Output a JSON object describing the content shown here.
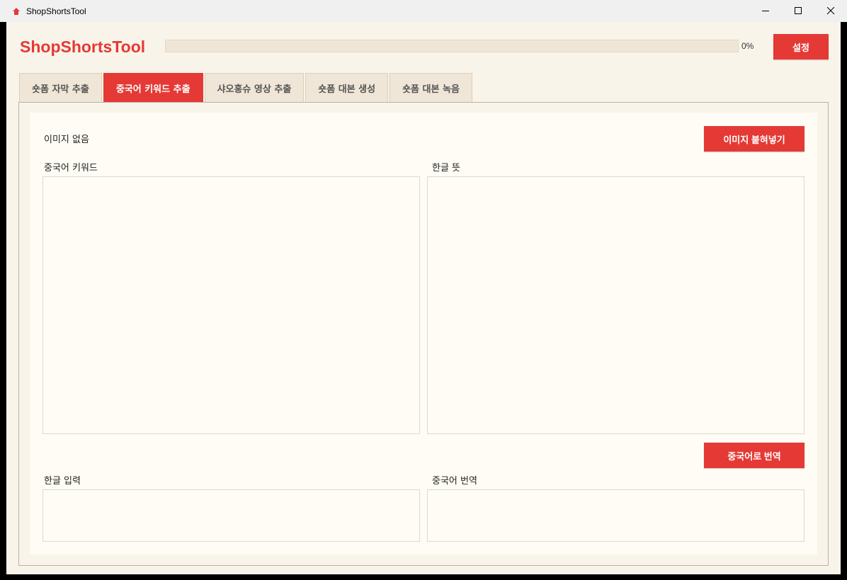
{
  "window": {
    "title": "ShopShortsTool"
  },
  "header": {
    "app_title": "ShopShortsTool",
    "progress": {
      "value": 0,
      "text": "0%"
    },
    "settings_label": "설정"
  },
  "tabs": [
    {
      "label": "숏폼 자막 추출",
      "active": false
    },
    {
      "label": "중국어 키워드 추출",
      "active": true
    },
    {
      "label": "샤오홍슈 영상 추출",
      "active": false
    },
    {
      "label": "숏폼 대본 생성",
      "active": false
    },
    {
      "label": "숏폼 대본 녹음",
      "active": false
    }
  ],
  "panel": {
    "image_status": "이미지 없음",
    "paste_image_label": "이미지 붙혀넣기",
    "chinese_keywords_label": "중국어 키워드",
    "korean_meaning_label": "한글 뜻",
    "translate_label": "중국어로 번역",
    "korean_input_label": "한글 입력",
    "chinese_translation_label": "중국어 번역"
  },
  "colors": {
    "accent": "#e53935",
    "background": "#f9f4ea",
    "panel": "#fefcf4",
    "tab_inactive": "#efe6d7"
  }
}
